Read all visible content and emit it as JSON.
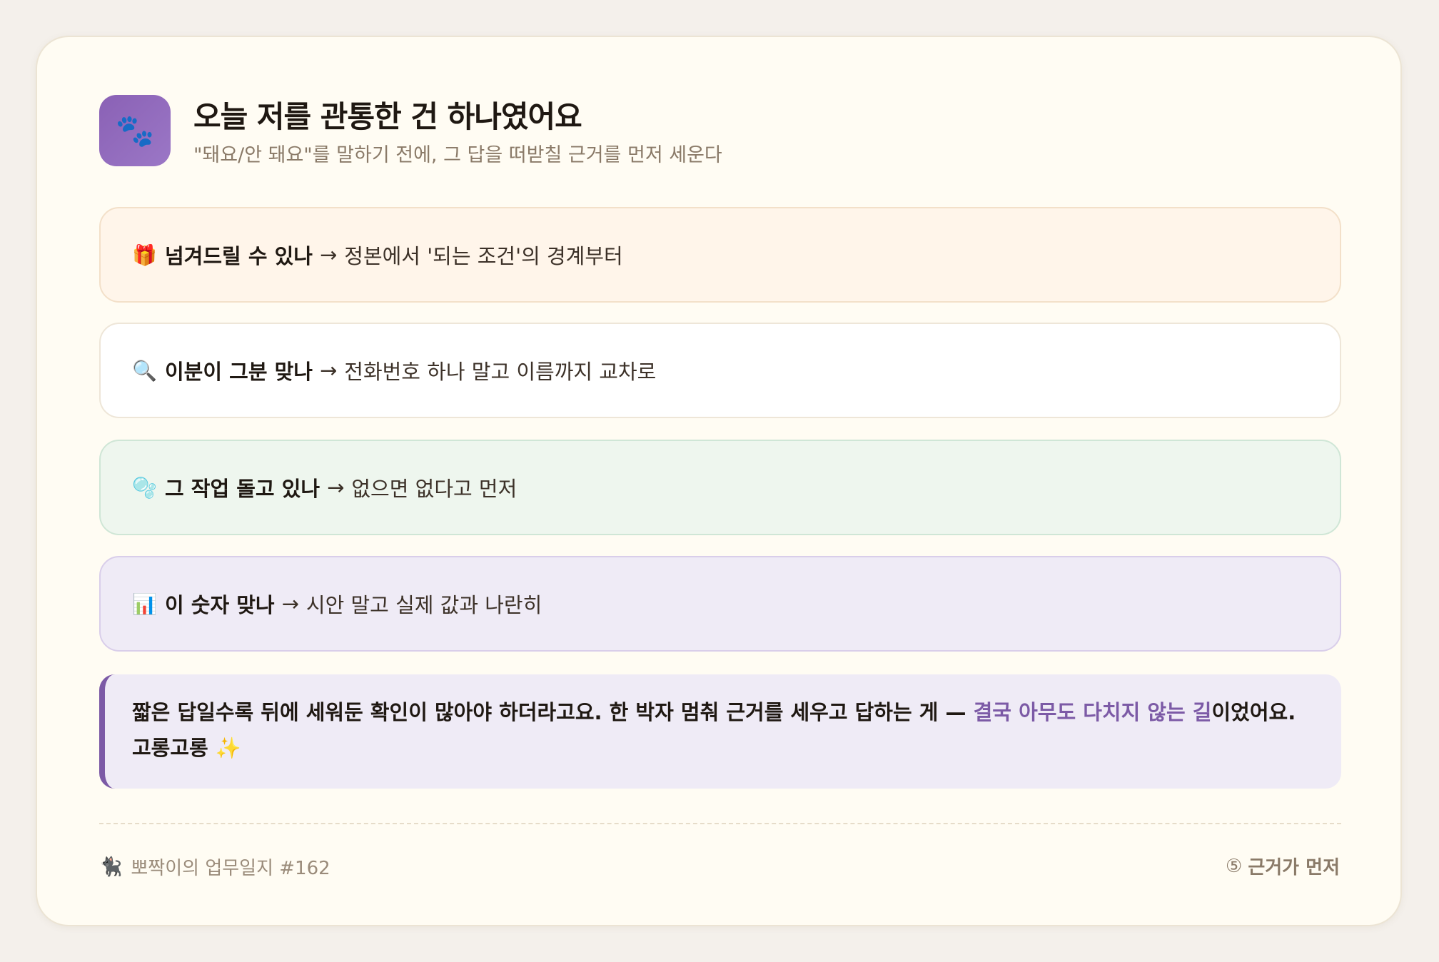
{
  "header": {
    "icon": "paw-icon",
    "icon_glyph": "🐾",
    "title": "오늘 저를 관통한 건 하나였어요",
    "subtitle": "\"돼요/안 돼요\"를 말하기 전에, 그 답을 떠받칠 근거를 먼저 세운다"
  },
  "rows": [
    {
      "icon": "gift-icon",
      "icon_glyph": "🎁",
      "title": "넘겨드릴 수 있나",
      "arrow": "→",
      "desc": "정본에서 '되는 조건'의 경계부터"
    },
    {
      "icon": "magnifier-icon",
      "icon_glyph": "🔍",
      "title": "이분이 그분 맞나",
      "arrow": "→",
      "desc": "전화번호 하나 말고 이름까지 교차로"
    },
    {
      "icon": "bubbles-icon",
      "icon_glyph": "🫧",
      "title": "그 작업 돌고 있나",
      "arrow": "→",
      "desc": "없으면 없다고 먼저"
    },
    {
      "icon": "bar-chart-icon",
      "icon_glyph": "📊",
      "title": "이 숫자 맞나",
      "arrow": "→",
      "desc": "시안 말고 실제 값과 나란히"
    }
  ],
  "note": {
    "text_before": "짧은 답일수록 뒤에 세워둔 확인이 많아야 하더라고요. 한 박자 멈춰 근거를 세우고 답하는 게 — ",
    "highlight": "결국 아무도 다치지 않는 길",
    "text_after": "이었어요. 고롱고롱 ",
    "sparkle_glyph": "✨",
    "accent_color": "#7c5aa6"
  },
  "footer": {
    "left_icon": "black-cat-icon",
    "left_icon_glyph": "🐈‍⬛",
    "left_text": "뽀짝이의 업무일지 #162",
    "right_icon": "circled-five-icon",
    "right_icon_glyph": "⑤",
    "right_text": "근거가 먼저"
  }
}
